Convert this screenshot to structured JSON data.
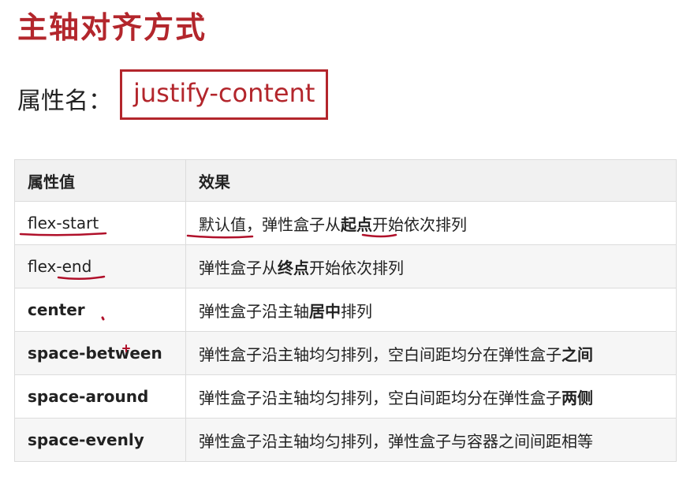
{
  "title": "主轴对齐方式",
  "property": {
    "label": "属性名：",
    "name": "justify-content"
  },
  "table": {
    "headers": [
      "属性值",
      "效果"
    ],
    "rows": [
      {
        "value": "flex-start",
        "value_bold": false,
        "effect": [
          {
            "t": "默认值，弹性盒子从"
          },
          {
            "t": "起点",
            "b": true
          },
          {
            "t": "开始依次排列"
          }
        ]
      },
      {
        "value": "flex-end",
        "value_bold": false,
        "effect": [
          {
            "t": "弹性盒子从"
          },
          {
            "t": "终点",
            "b": true
          },
          {
            "t": "开始依次排列"
          }
        ]
      },
      {
        "value": "center",
        "value_bold": true,
        "effect": [
          {
            "t": "弹性盒子沿主轴"
          },
          {
            "t": "居中",
            "b": true
          },
          {
            "t": "排列"
          }
        ]
      },
      {
        "value": "space-between",
        "value_bold": true,
        "effect": [
          {
            "t": "弹性盒子沿主轴均匀排列，空白间距均分在弹性盒子"
          },
          {
            "t": "之间",
            "b": true
          }
        ]
      },
      {
        "value": "space-around",
        "value_bold": true,
        "effect": [
          {
            "t": "弹性盒子沿主轴均匀排列，空白间距均分在弹性盒子"
          },
          {
            "t": "两侧",
            "b": true
          }
        ]
      },
      {
        "value": "space-evenly",
        "value_bold": true,
        "effect": [
          {
            "t": "弹性盒子沿主轴均匀排列，弹性盒子与容器之间间距相等"
          }
        ]
      }
    ]
  },
  "colors": {
    "accent": "#b3262c",
    "annotation": "#b0102a"
  }
}
